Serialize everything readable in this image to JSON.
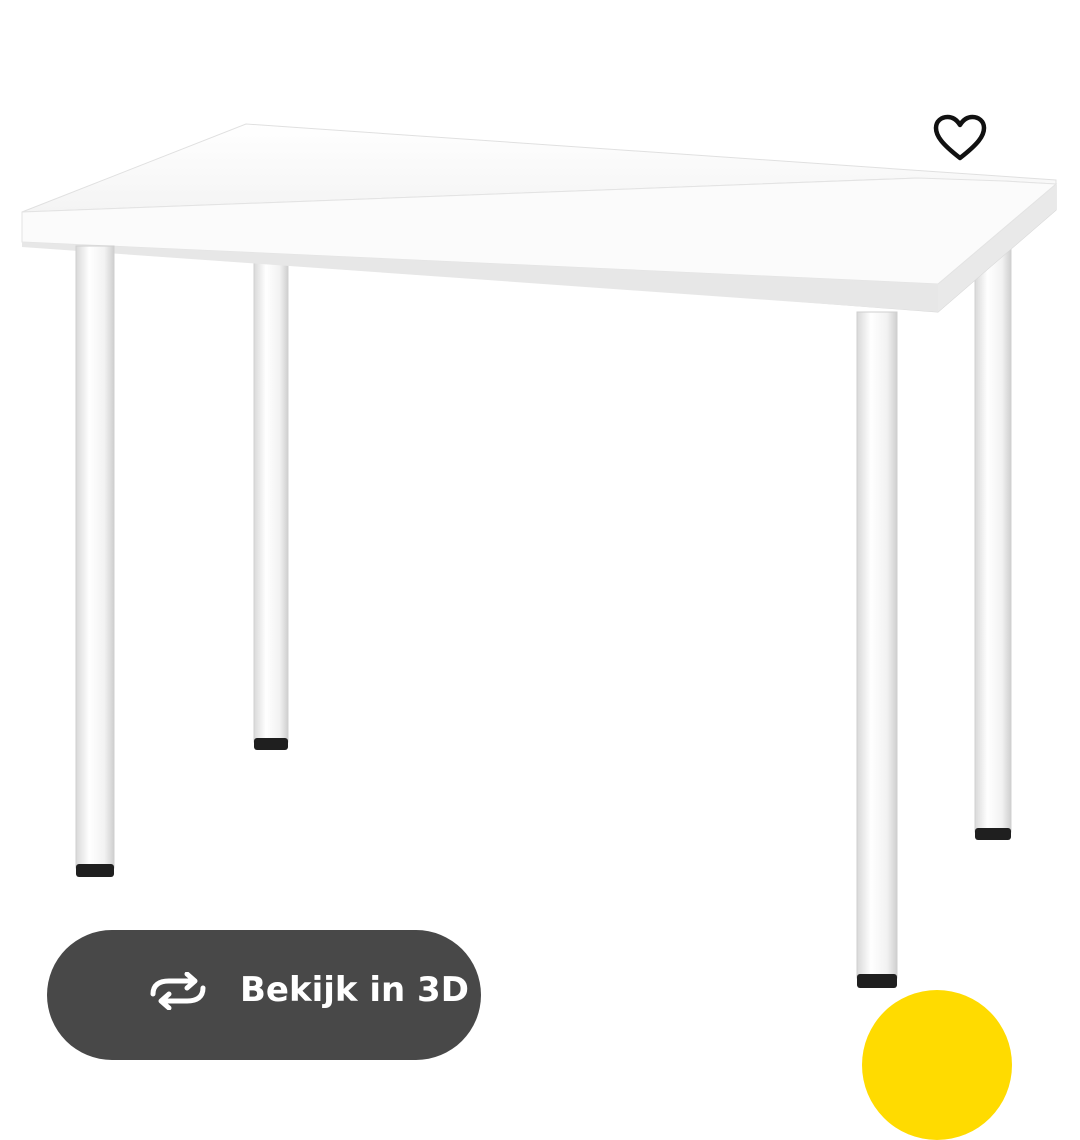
{
  "product_image": {
    "icon": "table-photo",
    "colors": {
      "table": "#ffffff",
      "shadow": "#e6e6e6",
      "feet": "#1f1f1f"
    }
  },
  "favorite": {
    "icon": "heart-outline-icon",
    "color": "#111111"
  },
  "view_3d": {
    "label": "Bekijk in 3D",
    "icon": "rotate-3d-icon",
    "background": "#484848",
    "text_color": "#ffffff"
  },
  "fab": {
    "color": "#ffdb00"
  }
}
